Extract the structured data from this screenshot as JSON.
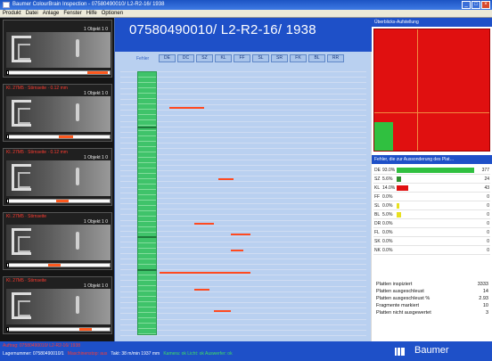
{
  "window": {
    "title": "Baumer ColourBrain Inspection - 07580490010/ L2-R2-16/ 1938"
  },
  "menu": [
    "Produkt",
    "Datei",
    "Anlage",
    "Fenster",
    "Hilfe",
    "Optionen"
  ],
  "cameras": [
    {
      "header": "",
      "sub": "1 Objekt 1  0",
      "bar_marks": [
        {
          "from": 0.78,
          "to": 0.98
        }
      ]
    },
    {
      "header": "Kl. 27M5 · Stirnseite · 0.12 mm",
      "sub": "1 Objekt 1  0",
      "bar_marks": [
        {
          "from": 0.5,
          "to": 0.64
        }
      ]
    },
    {
      "header": "Kl. 27M5 · Stirnseite · 0.12 mm",
      "sub": "1 Objekt 1  0",
      "bar_marks": [
        {
          "from": 0.48,
          "to": 0.6
        }
      ]
    },
    {
      "header": "Kl. 27M5 · Stirnseite",
      "sub": "1 Objekt 1  0",
      "bar_marks": [
        {
          "from": 0.4,
          "to": 0.52
        }
      ]
    },
    {
      "header": "Kl. 27M5 · Stirnseite",
      "sub": "1 Objekt 1  0",
      "bar_marks": [
        {
          "from": 0.7,
          "to": 0.82
        }
      ]
    }
  ],
  "main": {
    "order": "07580490010/ L2-R2-16/ 1938",
    "cols_label": "Fehler",
    "columns": [
      "DE",
      "DC",
      "SZ",
      "KL",
      "FF",
      "SL",
      "SR",
      "FK",
      "BL",
      "RR"
    ],
    "grid": {
      "rows": 48,
      "dark_rows": [
        10,
        30,
        36
      ],
      "defects": [
        {
          "row": 6,
          "from": 0.2,
          "to": 0.34
        },
        {
          "row": 19,
          "from": 0.4,
          "to": 0.46
        },
        {
          "row": 27,
          "from": 0.3,
          "to": 0.38
        },
        {
          "row": 29,
          "from": 0.45,
          "to": 0.53
        },
        {
          "row": 32,
          "from": 0.45,
          "to": 0.5
        },
        {
          "row": 36,
          "from": 0.16,
          "to": 0.53
        },
        {
          "row": 39,
          "from": 0.3,
          "to": 0.36
        },
        {
          "row": 43,
          "from": 0.38,
          "to": 0.45
        }
      ]
    }
  },
  "right": {
    "head": "Überblicks-Aufstellung",
    "defect_head": "Fehler, die zur Aussonderung des Plat…",
    "defects": [
      {
        "label": "DE",
        "pct": "93.0%",
        "frac": 0.92,
        "color": "#30c040",
        "count": "377"
      },
      {
        "label": "SZ",
        "pct": "5.6%",
        "frac": 0.05,
        "color": "#2f8f2f",
        "count": "24"
      },
      {
        "label": "KL",
        "pct": "14.0%",
        "frac": 0.14,
        "color": "#e01010",
        "count": "43"
      },
      {
        "label": "FF",
        "pct": "0.0%",
        "frac": 0.0,
        "color": "#e8e020",
        "count": "0"
      },
      {
        "label": "SL",
        "pct": "0.0%",
        "frac": 0.03,
        "color": "#e8e020",
        "count": "0"
      },
      {
        "label": "BL",
        "pct": "5.0%",
        "frac": 0.05,
        "color": "#e8e020",
        "count": "0"
      },
      {
        "label": "DR",
        "pct": "0.0%",
        "frac": 0.0,
        "color": "#e8e020",
        "count": "0"
      },
      {
        "label": "FL",
        "pct": "0.0%",
        "frac": 0.0,
        "color": "#e8e020",
        "count": "0"
      },
      {
        "label": "SK",
        "pct": "0.0%",
        "frac": 0.0,
        "color": "#e8e020",
        "count": "0"
      },
      {
        "label": "NK",
        "pct": "0.0%",
        "frac": 0.0,
        "color": "#e8e020",
        "count": "0"
      }
    ],
    "stats": [
      {
        "k": "Platten inspiziert",
        "v": "3333"
      },
      {
        "k": "Platten ausgeschleust",
        "v": "14"
      },
      {
        "k": "Platten ausgeschleust %",
        "v": "2.93"
      },
      {
        "k": "Fragmente markiert",
        "v": "10"
      },
      {
        "k": "Platten nicht ausgewertet",
        "v": "3"
      }
    ]
  },
  "footer": {
    "line1": "Auftrag: 07580490010/ L2-R2-16/ 1938",
    "line2_a": "Lagernummer: 07580490010/1",
    "line2_b": "Maschinenstop: aus",
    "line2_c": "Takt: 38 m/min   1937 mm",
    "line2_d": "Kamera: ok   Licht: ok   Auswerfer: ok"
  },
  "brand": {
    "name": "Baumer"
  }
}
